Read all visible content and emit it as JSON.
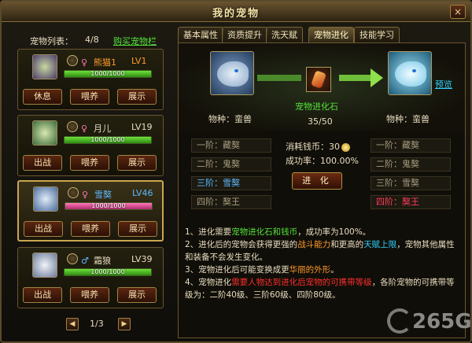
{
  "window": {
    "title": "我的宠物",
    "close": "×"
  },
  "list": {
    "label": "宠物列表：",
    "count": "4/8",
    "buy": "购买宠物栏"
  },
  "pets": [
    {
      "name": "熊猫1",
      "level": "LV1",
      "gender": "♀",
      "hp": "1000/1000",
      "hp_fraction": 1.0,
      "buttons": [
        "休息",
        "喂养",
        "展示"
      ],
      "selected": false
    },
    {
      "name": "月儿",
      "level": "LV19",
      "gender": "♀",
      "hp": "1000/1000",
      "hp_fraction": 1.0,
      "buttons": [
        "出战",
        "喂养",
        "展示"
      ],
      "selected": false
    },
    {
      "name": "雪獒",
      "level": "LV46",
      "gender": "♀",
      "hp": "1000/1000",
      "hp_fraction": 1.0,
      "buttons": [
        "出战",
        "喂养",
        "展示"
      ],
      "selected": true
    },
    {
      "name": "霜狼",
      "level": "LV39",
      "gender": "♂",
      "hp": "1000/1000",
      "hp_fraction": 1.0,
      "buttons": [
        "出战",
        "喂养",
        "展示"
      ],
      "selected": false
    }
  ],
  "pager": {
    "prev": "◀",
    "text": "1/3",
    "next": "▶"
  },
  "tabs": [
    "基本属性",
    "资质提升",
    "洗天赋",
    "宠物进化",
    "技能学习"
  ],
  "active_tab": 3,
  "evolution": {
    "from_species": "物种：蛮兽",
    "to_species": "物种：蛮兽",
    "stone_name": "宠物进化石",
    "stone_count": "35/50",
    "preview": "预览"
  },
  "stages": {
    "left": [
      "一阶：藏獒",
      "二阶：鬼獒",
      "三阶：雪獒",
      "四阶：獒王"
    ],
    "right": [
      "一阶：藏獒",
      "二阶：鬼獒",
      "三阶：雪獒",
      "四阶：獒王"
    ],
    "cost_label": "消耗钱币：",
    "cost_value": "30",
    "rate_label": "成功率：",
    "rate_value": "100.00%",
    "evolve_button": "进 化"
  },
  "description": {
    "l1a": "1、进化需要",
    "l1b": "宠物进化石和钱币",
    "l1c": "，成功率为100%。",
    "l2a": "2、进化后的宠物会获得更强的",
    "l2b": "战斗能力",
    "l2c": "和更高的",
    "l2d": "天赋上限",
    "l2e": "，宠物其他属性和装备不会发生变化。",
    "l3a": "3、宠物进化后可能变换成更",
    "l3b": "华丽的外形",
    "l3c": "。",
    "l4a": "4、宠物进化",
    "l4b": "需要人物达到进化后宠物的可携带等级",
    "l4c": "，各阶宠物的可携带等级为：二阶40级、三阶60级、四阶80级。"
  },
  "watermark": "265G",
  "colors": {
    "accent_green": "#54e23a",
    "accent_cyan": "#2fd0ff",
    "accent_red": "#ff3a5c",
    "gold": "#c9a650"
  }
}
